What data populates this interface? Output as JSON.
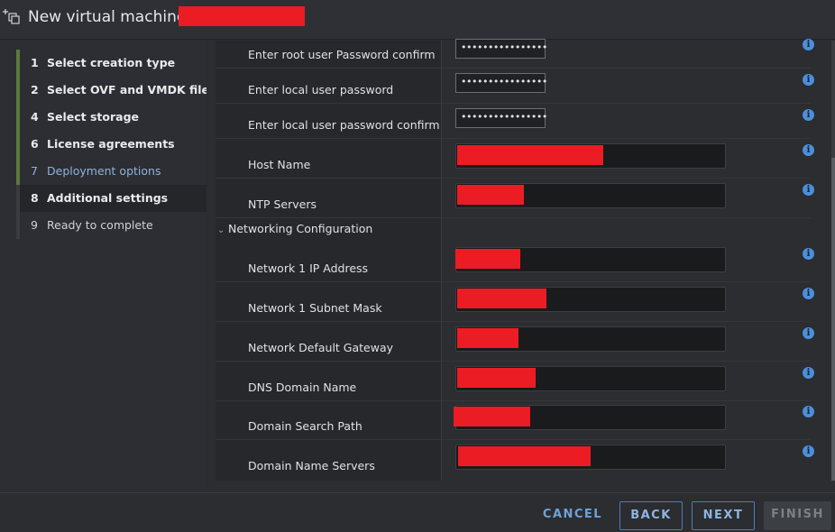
{
  "titlebar": {
    "title": "New virtual machine -",
    "icon": "add-vm-icon"
  },
  "steps": [
    {
      "num": "1",
      "label": "Select creation type"
    },
    {
      "num": "2",
      "label": "Select OVF and VMDK files"
    },
    {
      "num": "4",
      "label": "Select storage"
    },
    {
      "num": "6",
      "label": "License agreements"
    },
    {
      "num": "7",
      "label": "Deployment options"
    },
    {
      "num": "8",
      "label": "Additional settings"
    },
    {
      "num": "9",
      "label": "Ready to complete"
    }
  ],
  "form": {
    "root_pw_confirm": {
      "label": "Enter root user Password confirm",
      "value": "••••••••••••••••"
    },
    "local_pw": {
      "label": "Enter local user password",
      "value": "••••••••••••••••"
    },
    "local_pw_confirm": {
      "label": "Enter local user password confirm",
      "value": "••••••••••••••••"
    },
    "host_name": {
      "label": "Host Name"
    },
    "ntp_servers": {
      "label": "NTP Servers"
    },
    "networking_section": "Networking Configuration",
    "net1_ip": {
      "label": "Network 1 IP Address"
    },
    "net1_mask": {
      "label": "Network 1 Subnet Mask"
    },
    "gateway": {
      "label": "Network Default Gateway"
    },
    "dns_domain": {
      "label": "DNS Domain Name"
    },
    "search_path": {
      "label": "Domain Search Path"
    },
    "dns_servers": {
      "label": "Domain Name Servers"
    },
    "info_glyph": "i"
  },
  "footer": {
    "cancel": "CANCEL",
    "back": "BACK",
    "next": "NEXT",
    "finish": "FINISH"
  },
  "colors": {
    "accent": "#4b80b8",
    "completed_bar": "#5a7a3a",
    "redaction": "#ec1c24",
    "info": "#4b8fdc"
  }
}
